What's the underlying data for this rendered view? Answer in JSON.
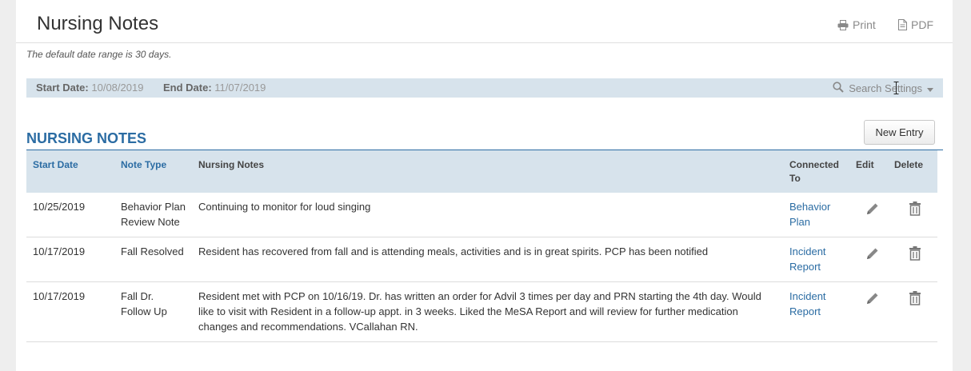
{
  "header": {
    "title": "Nursing Notes",
    "print_label": "Print",
    "pdf_label": "PDF"
  },
  "hint": "The default date range is 30 days.",
  "filter": {
    "start_label": "Start Date:",
    "start_value": "10/08/2019",
    "end_label": "End Date:",
    "end_value": "11/07/2019",
    "search_label": "Search Settings"
  },
  "section": {
    "title": "NURSING NOTES",
    "new_entry_label": "New Entry"
  },
  "table": {
    "columns": [
      "Start Date",
      "Note Type",
      "Nursing Notes",
      "Connected To",
      "Edit",
      "Delete"
    ],
    "rows": [
      {
        "date": "10/25/2019",
        "type": "Behavior Plan Review Note",
        "note": "Continuing to monitor for loud singing",
        "connected": "Behavior Plan"
      },
      {
        "date": "10/17/2019",
        "type": "Fall Resolved",
        "note": "Resident has recovered from fall and is attending meals, activities and is in great spirits. PCP has been notified",
        "connected": "Incident Report"
      },
      {
        "date": "10/17/2019",
        "type": "Fall Dr. Follow Up",
        "note": "Resident met with PCP on 10/16/19. Dr. has written an order for Advil 3 times per day and PRN starting the 4th day. Would like to visit with Resident in a follow-up appt. in 3 weeks. Liked the MeSA Report and will review for further medication changes and recommendations. VCallahan RN.",
        "connected": "Incident Report"
      }
    ]
  },
  "icons": {
    "print": "printer-icon",
    "pdf": "document-icon",
    "search": "magnifier-icon",
    "caret": "caret-down-icon",
    "edit": "pencil-icon",
    "delete": "trash-icon"
  },
  "colors": {
    "accent": "#2b6ca3",
    "filter_bg": "#d7e3ec",
    "page_bg": "#eeeeee"
  }
}
